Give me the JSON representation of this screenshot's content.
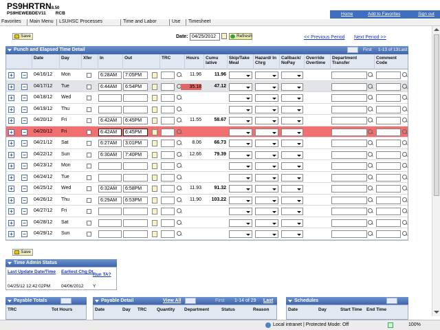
{
  "header": {
    "app_name": "PS9HRTRN",
    "app_version": "8.50",
    "db_name": "PS9HEWEBDEV11",
    "db_user": "RCB",
    "links": [
      "Home",
      "Add to Favorites",
      "Sign out"
    ]
  },
  "breadcrumbs": [
    "Favorites",
    "Main Menu",
    "LSUHSC Processes",
    "Time and Labor",
    "Use",
    "Timesheet"
  ],
  "toolbar": {
    "save_label": "Save",
    "date_label": "Date:",
    "date_value": "04/25/2012",
    "refresh_label": "Refresh",
    "prev_period": "<< Previous Period",
    "next_period": "Next Period >>"
  },
  "grid": {
    "title": "Punch and Elapsed Time Detail",
    "pager_first": "First",
    "pager_range": "1-13 of 13",
    "pager_last": "Last",
    "columns": [
      "Date",
      "Day",
      "Xfer",
      "In",
      "Out",
      "TRC",
      "Hours",
      "Cumu lative",
      "Skip/Take Meal",
      "Hazard/ In Chrg",
      "Callback/ NoPay",
      "Override Overtime",
      "Department Transfer",
      "Comment Code"
    ],
    "rows": [
      {
        "date": "04/16/12",
        "day": "Mon",
        "in": "6:28AM",
        "out": "7:05PM",
        "hours": "11.96",
        "cum": "11.96"
      },
      {
        "date": "04/17/12",
        "day": "Tue",
        "in": "6:44AM",
        "out": "6:54PM",
        "hours": "35.18",
        "cum": "47.12"
      },
      {
        "date": "04/18/12",
        "day": "Wed",
        "in": "",
        "out": "",
        "hours": "",
        "cum": ""
      },
      {
        "date": "04/19/12",
        "day": "Thu",
        "in": "",
        "out": "",
        "hours": "",
        "cum": ""
      },
      {
        "date": "04/20/12",
        "day": "Fri",
        "in": "6:42AM",
        "out": "6:45PM",
        "hours": "11.55",
        "cum": "58.67"
      },
      {
        "date": "04/20/12",
        "day": "Fri",
        "in": "6:42AM",
        "out": "6:45PM",
        "hours": "",
        "cum": ""
      },
      {
        "date": "04/21/12",
        "day": "Sat",
        "in": "6:27AM",
        "out": "3:01PM",
        "hours": "8.06",
        "cum": "66.73"
      },
      {
        "date": "04/22/12",
        "day": "Sun",
        "in": "6:30AM",
        "out": "7:40PM",
        "hours": "12.66",
        "cum": "79.39"
      },
      {
        "date": "04/23/12",
        "day": "Mon",
        "in": "",
        "out": "",
        "hours": "",
        "cum": ""
      },
      {
        "date": "04/24/12",
        "day": "Tue",
        "in": "",
        "out": "",
        "hours": "",
        "cum": ""
      },
      {
        "date": "04/25/12",
        "day": "Wed",
        "in": "6:32AM",
        "out": "6:58PM",
        "hours": "11.93",
        "cum": "91.32"
      },
      {
        "date": "04/26/12",
        "day": "Thu",
        "in": "6:29AM",
        "out": "6:53PM",
        "hours": "11.90",
        "cum": "103.22"
      },
      {
        "date": "04/27/12",
        "day": "Fri",
        "in": "",
        "out": "",
        "hours": "",
        "cum": ""
      },
      {
        "date": "04/28/12",
        "day": "Sat",
        "in": "",
        "out": "",
        "hours": "",
        "cum": ""
      },
      {
        "date": "04/29/12",
        "day": "Sun",
        "in": "",
        "out": "",
        "hours": "",
        "cum": ""
      }
    ]
  },
  "bottom_save_label": "Save",
  "time_admin": {
    "title": "Time Admin Status",
    "col1": "Last Update Date/Time",
    "col2": "Earliest Chg Dt",
    "col3": "Run TA?",
    "val1": "04/25/12 12:42:02PM",
    "val2": "04/06/2012",
    "val3": "Y"
  },
  "payable_totals": {
    "title": "Payable Totals",
    "cols": [
      "TRC",
      "Tot Hours"
    ]
  },
  "payable_detail": {
    "title": "Payable Detail",
    "view_all": "View All",
    "first": "First",
    "range": "1-14 of 29",
    "last": "Last",
    "cols": [
      "Date",
      "Day",
      "TRC",
      "Quantity",
      "Department",
      "Status",
      "Reason"
    ]
  },
  "schedules": {
    "title": "Schedules",
    "cols": [
      "Date",
      "Day",
      "Start Time",
      "End Time"
    ]
  },
  "statusbar": {
    "zone": "Local intranet | Protected Mode: Off",
    "zoom": "100%"
  },
  "colors": {
    "accent": "#3e65ad",
    "selected_row": "#f16f6f",
    "link": "#1a36c4"
  }
}
